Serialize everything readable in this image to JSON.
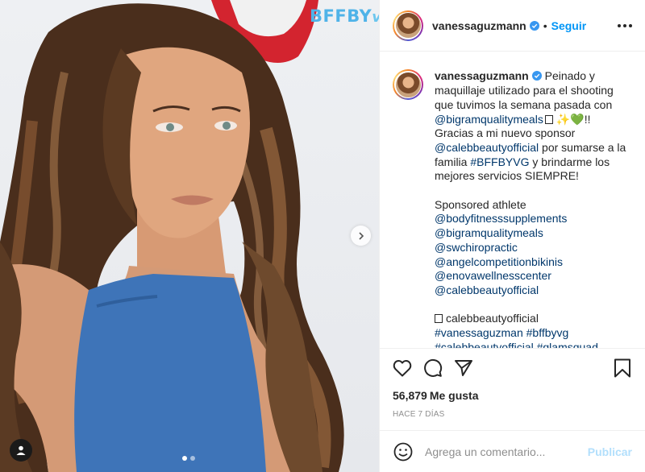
{
  "colors": {
    "accent": "#0095f6",
    "link": "#00376b",
    "publish_disabled": "#b2dffc",
    "watermark": "#4fb3e8",
    "muted": "#8e8e8e"
  },
  "media": {
    "watermark_main": "BFFBY",
    "watermark_sub": "vg",
    "next_icon": "chevron-right-icon",
    "tag_icon": "user-tag-icon",
    "carousel_total": 2,
    "carousel_active": 1
  },
  "header": {
    "username": "vanessaguzmann",
    "separator": "•",
    "follow_label": "Seguir",
    "verified_icon": "verified-badge-icon",
    "more_icon": "more-options-icon"
  },
  "caption": {
    "username": "vanessaguzmann",
    "line1_text": "Peinado y",
    "line2": "maquillaje utilizado para el shooting",
    "line3": "que tuvimos la semana pasada con",
    "line4_link": "@bigramqualitymeals",
    "line4_emoji": "✨💚!!",
    "line5": "Gracias a mi nuevo sponsor",
    "line6_link": "@calebbeautyofficial",
    "line6_text": "por sumarse a la",
    "line7_text": "familia",
    "line7_hashtag": "#BFFBYVG",
    "line7_rest": "y brindarme los",
    "line8": "mejores servicios SIEMPRE!",
    "sponsored_heading": "Sponsored athlete",
    "sponsors": [
      "@bodyfitnesssupplements",
      "@bigramqualitymeals",
      "@swchiropractic",
      "@angelcompetitionbikinis",
      "@enovawellnesscenter",
      "@calebbeautyofficial"
    ],
    "tag_line_text": "calebbeautyofficial",
    "hashtags_line1": "#vanessaguzman #bffbyvg",
    "hashtags_line2": "#calebbeautyofficial #glamsquad"
  },
  "actions": {
    "like_icon": "heart-icon",
    "comment_icon": "comment-icon",
    "share_icon": "share-icon",
    "save_icon": "bookmark-icon"
  },
  "likes": {
    "count": "56,879",
    "label": "Me gusta"
  },
  "age": "HACE 7 DÍAS",
  "add_comment": {
    "emoji_icon": "emoji-icon",
    "placeholder": "Agrega un comentario...",
    "publish_label": "Publicar"
  }
}
